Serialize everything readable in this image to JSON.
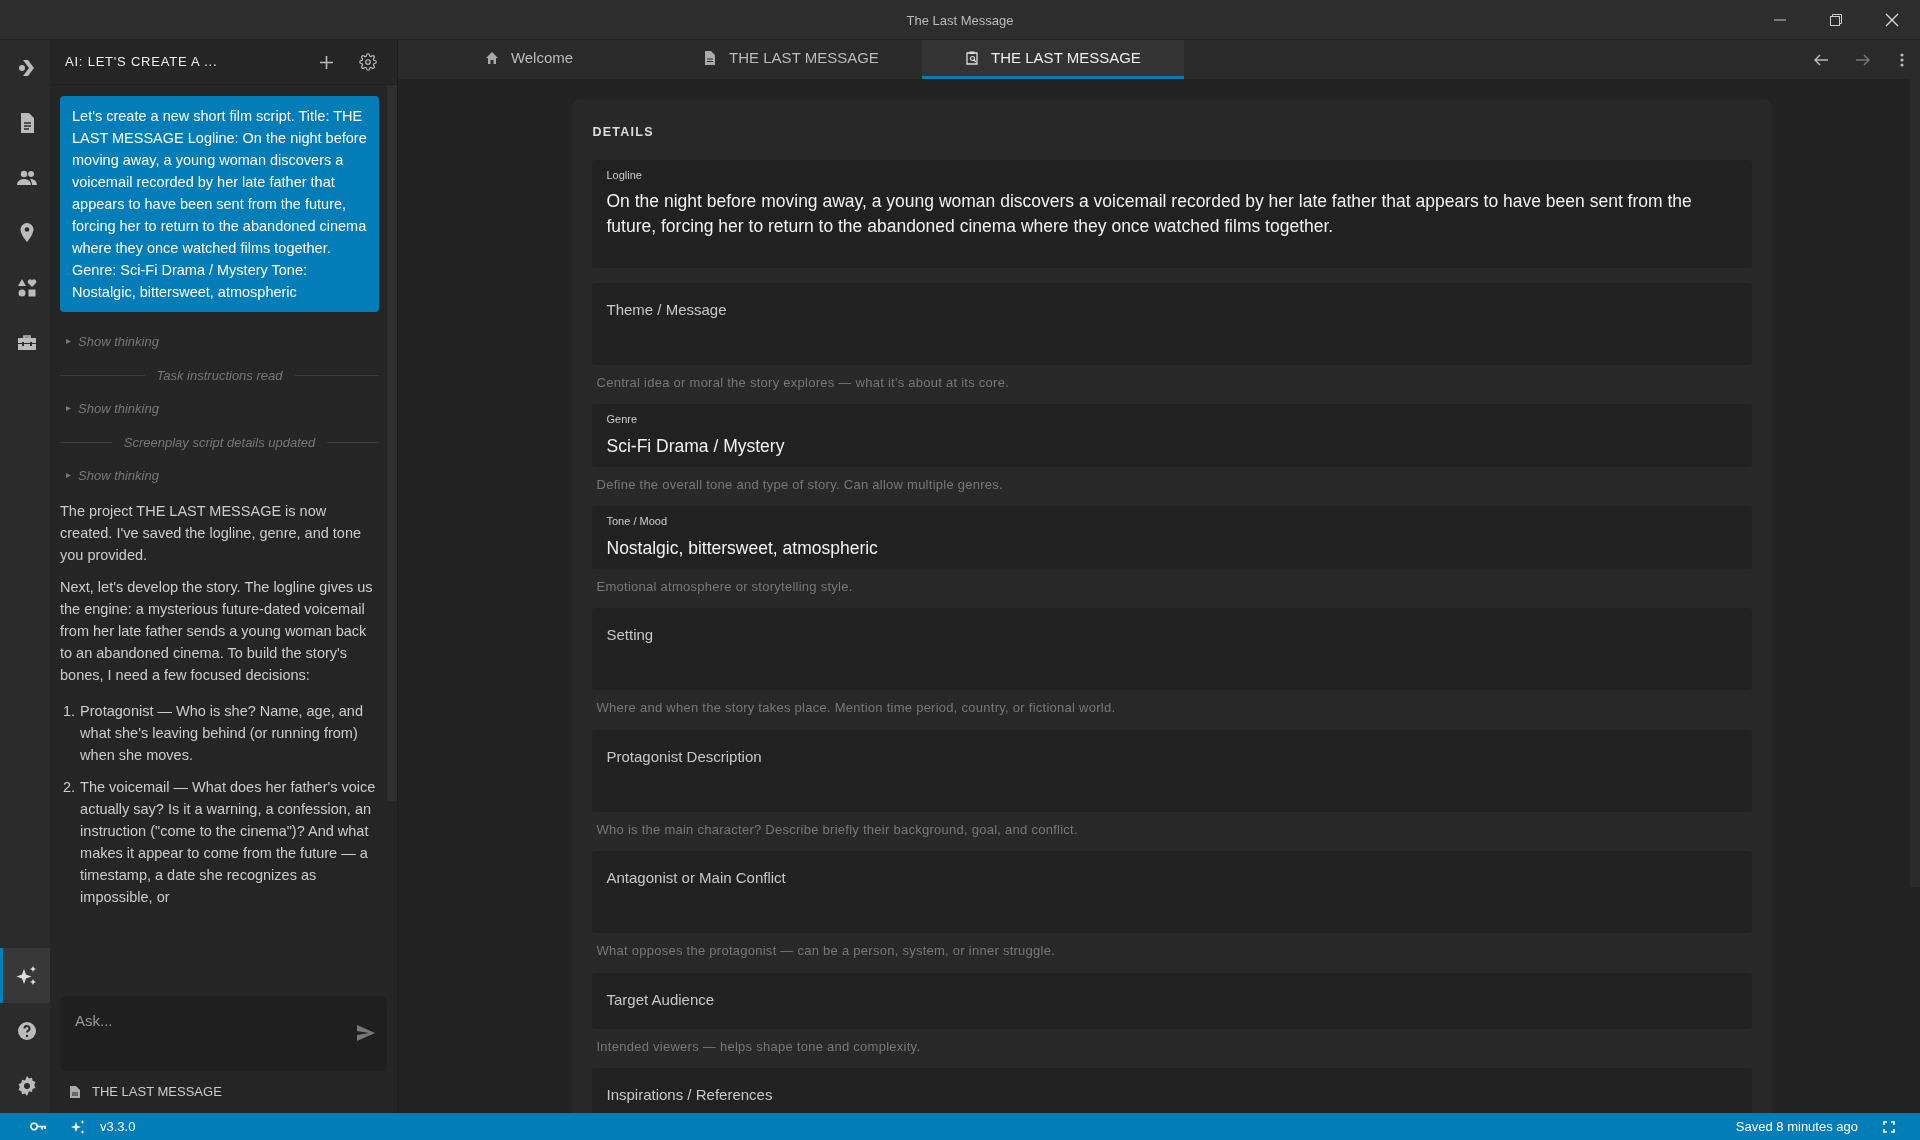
{
  "window": {
    "title": "The Last Message"
  },
  "activity_bar": {
    "top": [
      {
        "selected": false
      },
      {
        "selected": false
      },
      {
        "selected": false
      },
      {
        "selected": false
      },
      {
        "selected": false
      },
      {
        "selected": false
      }
    ],
    "bottom": [
      {
        "selected": true
      },
      {
        "selected": false
      },
      {
        "selected": false
      }
    ]
  },
  "chat": {
    "title": "AI: LET'S CREATE A ...",
    "messages": [
      {
        "kind": "user",
        "text": "Let's create a new short film script. Title: THE LAST MESSAGE Logline: On the night before moving away, a young woman discovers a voicemail recorded by her late father that appears to have been sent from the future, forcing her to return to the abandoned cinema where they once watched films together. Genre: Sci-Fi Drama / Mystery Tone: Nostalgic, bittersweet, atmospheric"
      },
      {
        "kind": "thinking",
        "text": "Show thinking",
        "expanded": false
      },
      {
        "kind": "divider",
        "text": "Task instructions read"
      },
      {
        "kind": "thinking",
        "text": "Show thinking",
        "expanded": false
      },
      {
        "kind": "divider",
        "text": "Screenplay script details updated"
      },
      {
        "kind": "thinking",
        "text": "Show thinking",
        "expanded": false
      },
      {
        "kind": "paragraph",
        "text": "The project THE LAST MESSAGE is now created. I've saved the logline, genre, and tone you provided."
      },
      {
        "kind": "paragraph",
        "text": "Next, let's develop the story. The logline gives us the engine: a mysterious future-dated voicemail from her late father sends a young woman back to an abandoned cinema. To build the story's bones, I need a few focused decisions:"
      },
      {
        "kind": "list",
        "items": [
          {
            "number": "1.",
            "text": "Protagonist — Who is she? Name, age, and what she's leaving behind (or running from) when she moves."
          },
          {
            "number": "2.",
            "text": "The voicemail — What does her father's voice actually say? Is it a warning, a confession, an instruction (\"come to the cinema\")? And what makes it appear to come from the future — a timestamp, a date she recognizes as impossible, or"
          }
        ]
      }
    ],
    "input": {
      "placeholder": "Ask..."
    },
    "context": "THE LAST MESSAGE"
  },
  "tabs": [
    {
      "label": "Welcome",
      "selected": false
    },
    {
      "label": "THE LAST MESSAGE",
      "selected": false
    },
    {
      "label": "THE LAST MESSAGE",
      "selected": true
    }
  ],
  "details": {
    "heading": "DETAILS",
    "fields": [
      {
        "label": "Logline",
        "value": "On the night before moving away, a young woman discovers a voicemail recorded by her late father that appears to have been sent from the future, forcing her to return to the abandoned cinema where they once watched films together.",
        "kind": "area"
      },
      {
        "label": "Theme / Message",
        "hint": "Central idea or moral the story explores — what it's about at its core.",
        "kind": "area"
      },
      {
        "label": "Genre",
        "value": "Sci-Fi Drama / Mystery",
        "hint": "Define the overall tone and type of story. Can allow multiple genres.",
        "kind": "line"
      },
      {
        "label": "Tone / Mood",
        "value": "Nostalgic, bittersweet, atmospheric",
        "hint": "Emotional atmosphere or storytelling style.",
        "kind": "line"
      },
      {
        "label": "Setting",
        "hint": "Where and when the story takes place. Mention time period, country, or fictional world.",
        "kind": "area"
      },
      {
        "label": "Protagonist Description",
        "hint": "Who is the main character? Describe briefly their background, goal, and conflict.",
        "kind": "area"
      },
      {
        "label": "Antagonist or Main Conflict",
        "hint": "What opposes the protagonist — can be a person, system, or inner struggle.",
        "kind": "area"
      },
      {
        "label": "Target Audience",
        "hint": "Intended viewers — helps shape tone and complexity.",
        "kind": "line"
      },
      {
        "label": "Inspirations / References",
        "kind": "area"
      }
    ]
  },
  "status_bar": {
    "version": "v3.3.0",
    "saved": "Saved 8 minutes ago"
  }
}
